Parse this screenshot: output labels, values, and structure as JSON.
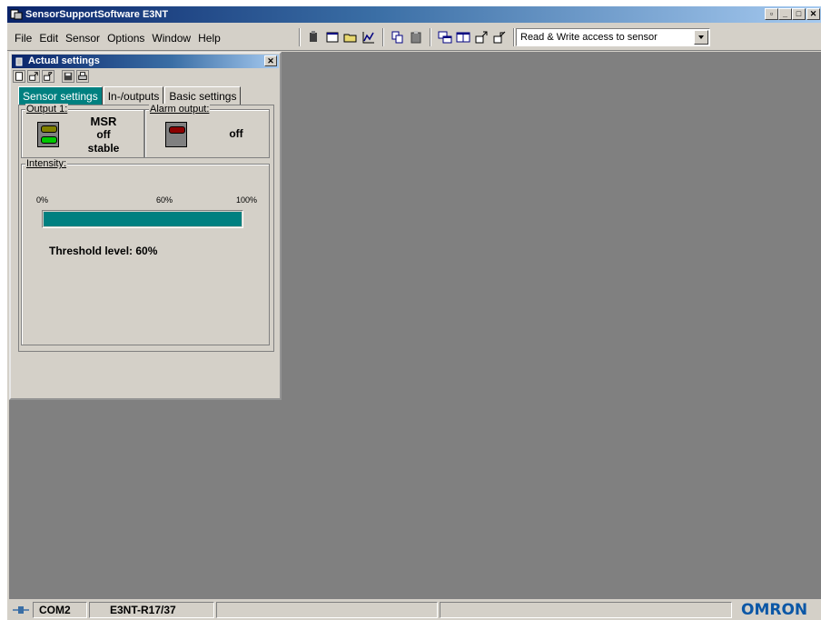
{
  "window": {
    "title": "SensorSupportSoftware E3NT",
    "controls": [
      "minimize-icon",
      "restore-icon",
      "close-icon"
    ]
  },
  "menu": [
    "File",
    "Edit",
    "Sensor",
    "Options",
    "Window",
    "Help"
  ],
  "toolbar": {
    "icons": [
      "sensor-icon",
      "window-icon",
      "open-folder-icon",
      "chart-icon",
      "copy-icon",
      "paste-icon",
      "tile-icon",
      "cascade-icon",
      "upload-icon",
      "download-icon"
    ],
    "access_mode": "Read & Write access to sensor"
  },
  "child_window": {
    "title": "Actual settings",
    "tool_icons": [
      "new-icon",
      "import-icon",
      "export-icon",
      "save-icon",
      "print-icon"
    ],
    "tabs": [
      "Sensor settings",
      "In-/outputs",
      "Basic settings"
    ],
    "active_tab": 0,
    "output1": {
      "label": "Output 1:",
      "mode": "MSR",
      "state": "off",
      "stability": "stable",
      "colors": {
        "top": "#808000",
        "bottom": "#00c800"
      }
    },
    "alarm": {
      "label": "Alarm output:",
      "state": "off",
      "color": "#8b0000"
    },
    "intensity": {
      "label": "Intensity:",
      "scale": [
        "0%",
        "60%",
        "100%"
      ],
      "level_percent": 100,
      "bar_color": "#008080",
      "threshold_text": "Threshold level: 60%"
    }
  },
  "statusbar": {
    "port": "COM2",
    "sensor_model": "E3NT-R17/37",
    "brand": "OMRON",
    "brand_color": "#0b57a6"
  }
}
